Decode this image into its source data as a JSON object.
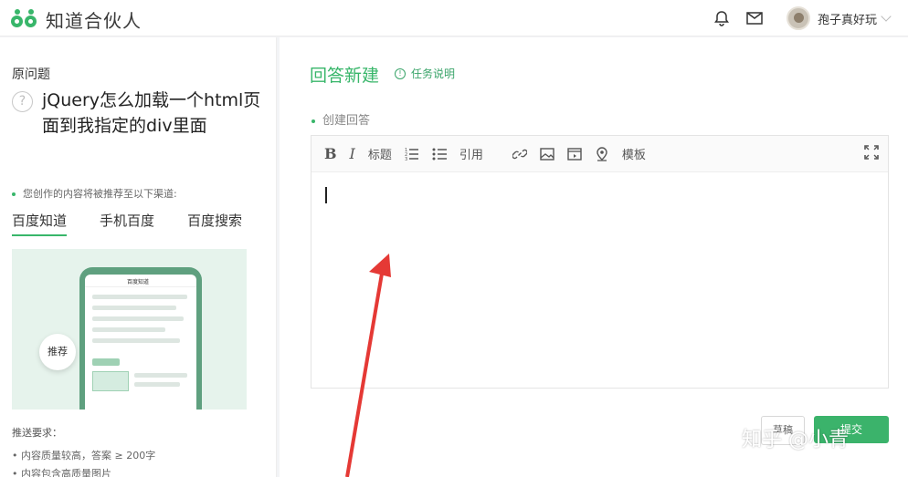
{
  "header": {
    "logo_text": "知道合伙人",
    "username": "孢子真好玩"
  },
  "question": {
    "label": "原问题",
    "title": "jQuery怎么加载一个html页面到我指定的div里面"
  },
  "recommend": {
    "note": "您创作的内容将被推荐至以下渠道:",
    "channels": [
      "百度知道",
      "手机百度",
      "百度搜索"
    ],
    "preview_bar_title": "百度知道",
    "preview_badge": "推荐"
  },
  "push": {
    "label": "推送要求：",
    "items": [
      "• 内容质量较高，答案 ≥ 200字",
      "• 内容包含高质量图片"
    ]
  },
  "answer": {
    "title": "回答新建",
    "task_link": "任务说明",
    "create_label": "创建回答"
  },
  "toolbar": {
    "bold": "B",
    "italic": "I",
    "heading": "标题",
    "quote": "引用",
    "template": "模板"
  },
  "buttons": {
    "draft": "草稿",
    "submit": "提交"
  },
  "watermark": "知乎 @小青",
  "colors": {
    "accent": "#38b66a",
    "arrow": "#e53935"
  }
}
